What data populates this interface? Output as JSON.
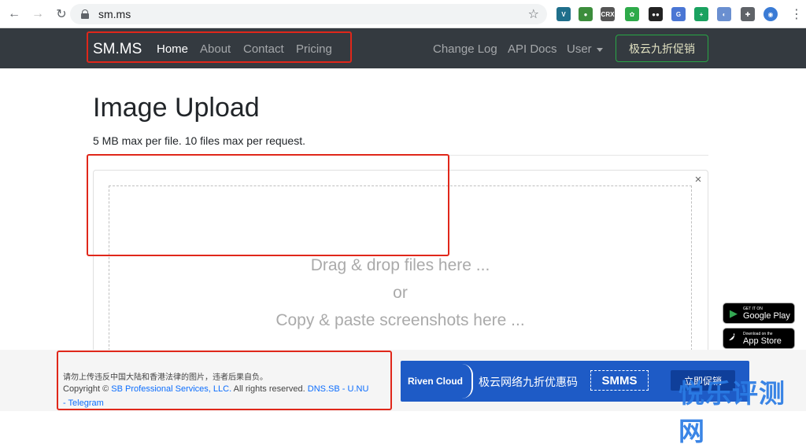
{
  "browser": {
    "url": "sm.ms",
    "back_glyph": "←",
    "forward_glyph": "→",
    "reload_glyph": "↻",
    "star_glyph": "☆",
    "menu_glyph": "⋮",
    "extensions": [
      {
        "name": "vue-devtools",
        "text": "V",
        "color": "#1f6f8b"
      },
      {
        "name": "globe-extension",
        "text": "●",
        "color": "#3c8d3c"
      },
      {
        "name": "crx-extension",
        "text": "CRX",
        "color": "#555555"
      },
      {
        "name": "gear-extension",
        "text": "✿",
        "color": "#2eaa4a"
      },
      {
        "name": "tampermonkey",
        "text": "●●",
        "color": "#222222"
      },
      {
        "name": "translate-extension",
        "text": "G",
        "color": "#4a76d4"
      },
      {
        "name": "plus-extension",
        "text": "+",
        "color": "#1aa260"
      },
      {
        "name": "note-extension",
        "text": "◐",
        "color": "#6a8fd0"
      },
      {
        "name": "puzzle-extension",
        "text": "✚",
        "color": "#5f6368"
      },
      {
        "name": "profile-avatar",
        "text": "◉",
        "color": "#3a7bd5"
      }
    ]
  },
  "navbar": {
    "brand": "SM.MS",
    "links": [
      "Home",
      "About",
      "Contact",
      "Pricing"
    ],
    "right_links": [
      "Change Log",
      "API Docs",
      "User"
    ],
    "promo_button": "极云九折促销"
  },
  "main": {
    "title": "Image Upload",
    "subtitle": "5 MB max per file. 10 files max per request.",
    "close_glyph": "×",
    "drop_lines": [
      "Drag & drop files here ...",
      "or",
      "Copy & paste screenshots here ..."
    ]
  },
  "badges": [
    {
      "small": "GET IT ON",
      "big": "Google Play",
      "icon": "▶"
    },
    {
      "small": "Download on the",
      "big": "App Store",
      "icon": ""
    }
  ],
  "footer": {
    "notice": "请勿上传违反中国大陆和香港法律的图片，违者后果自负。",
    "copyright_prefix": "Copyright © ",
    "company": "SB Professional Services, LLC.",
    "rights": " All rights reserved. ",
    "link_dns": "DNS.SB",
    "sep1": " - ",
    "link_unu": "U.NU",
    "sep2": "- ",
    "link_telegram": "Telegram"
  },
  "ad": {
    "brand": "Riven Cloud",
    "slogan": "极云网络九折优惠码",
    "code": "SMMS",
    "button": "立即促销"
  },
  "watermark": "悦乐评测网",
  "colors": {
    "navbar_bg": "#343a40",
    "annotation_red": "#e0271a",
    "ad_blue": "#1e5bc6",
    "link_blue": "#0d6efd"
  }
}
